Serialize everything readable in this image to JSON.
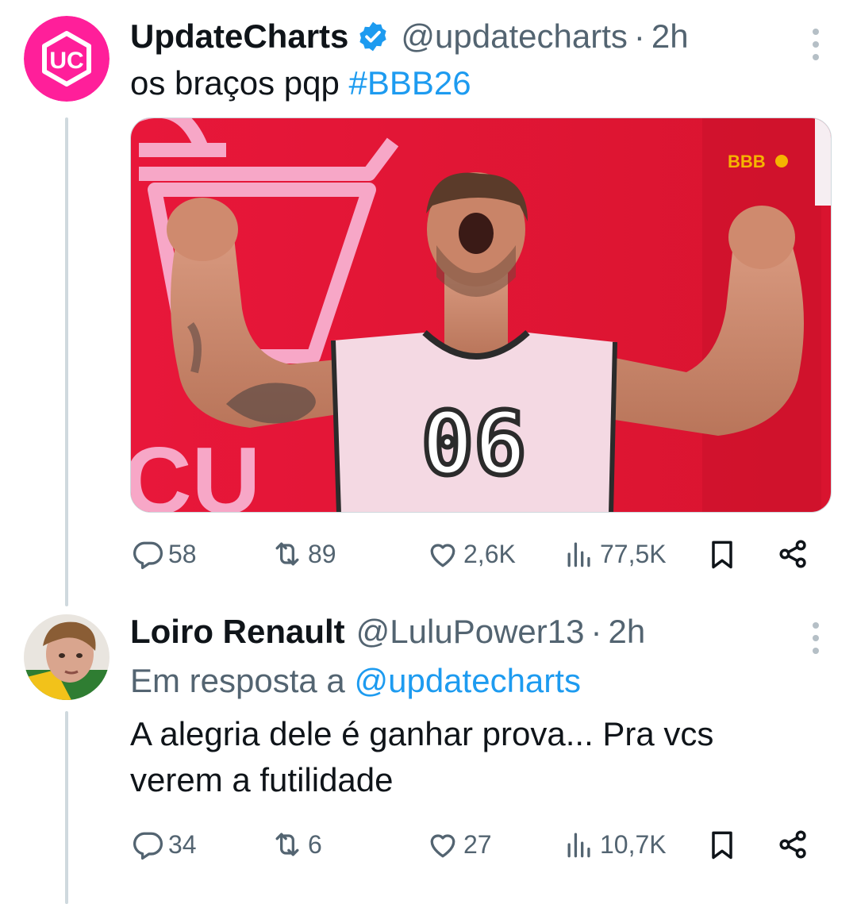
{
  "tweets": [
    {
      "name": "UpdateCharts",
      "handle": "@updatecharts",
      "separator": "·",
      "time": "2h",
      "verified": true,
      "avatar_text": "UC",
      "text": "os braços pqp ",
      "hashtag": "#BBB26",
      "media": {
        "jersey_number": "06",
        "watermark": "BBB",
        "bg_letters": "CU"
      },
      "actions": {
        "replies": "58",
        "retweets": "89",
        "likes": "2,6K",
        "views": "77,5K"
      }
    },
    {
      "name": "Loiro Renault",
      "handle": "@LuluPower13",
      "separator": "·",
      "time": "2h",
      "reply_prefix": "Em resposta a",
      "reply_handle": "@updatecharts",
      "text_line1": "A alegria dele é ganhar prova... Pra vcs",
      "text_line2": "verem a futilidade",
      "actions": {
        "replies": "34",
        "retweets": "6",
        "likes": "27",
        "views": "10,7K"
      }
    }
  ],
  "colors": {
    "link": "#1d9bf0",
    "secondary": "#536471",
    "brand_pink": "#ff1f9a",
    "media_red": "#e0183a"
  },
  "icons": [
    "verified-badge-icon",
    "more-icon",
    "reply-icon",
    "retweet-icon",
    "like-icon",
    "views-icon",
    "bookmark-icon",
    "share-icon"
  ]
}
